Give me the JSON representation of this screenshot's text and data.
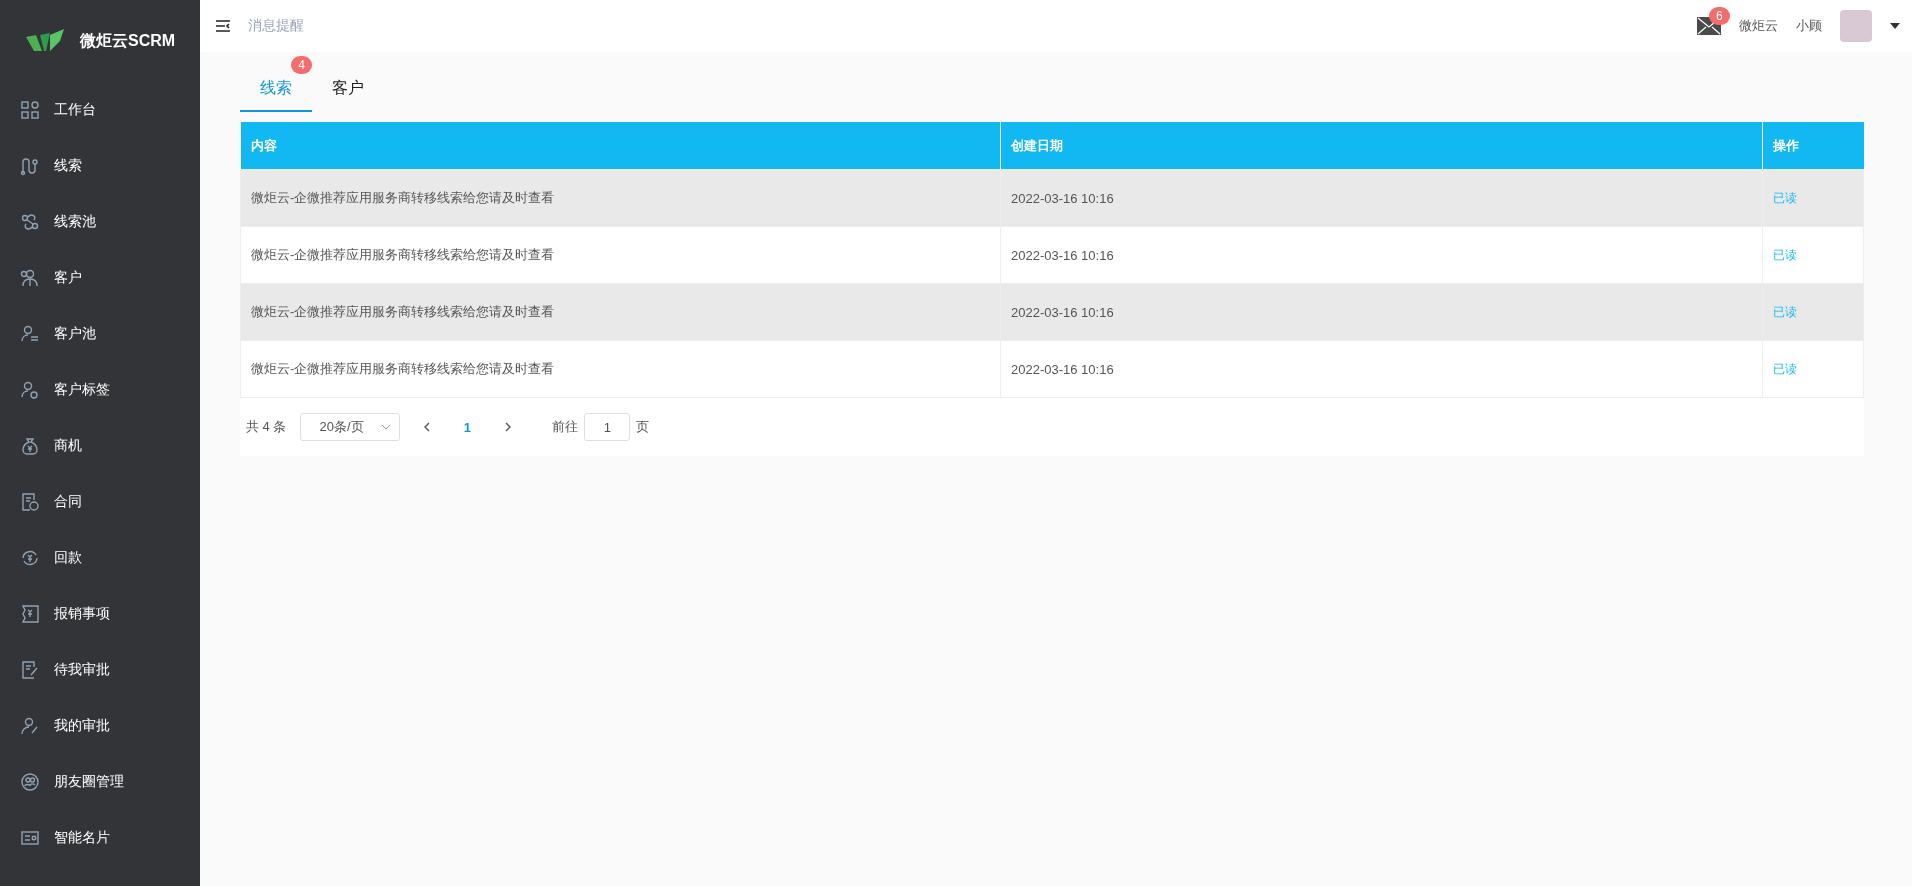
{
  "sidebar": {
    "logo_text": "微炬云SCRM",
    "items": [
      {
        "label": "工作台"
      },
      {
        "label": "线索"
      },
      {
        "label": "线索池"
      },
      {
        "label": "客户"
      },
      {
        "label": "客户池"
      },
      {
        "label": "客户标签"
      },
      {
        "label": "商机"
      },
      {
        "label": "合同"
      },
      {
        "label": "回款"
      },
      {
        "label": "报销事项"
      },
      {
        "label": "待我审批"
      },
      {
        "label": "我的审批"
      },
      {
        "label": "朋友圈管理"
      },
      {
        "label": "智能名片"
      }
    ]
  },
  "header": {
    "title": "消息提醒",
    "mail_badge": "6",
    "company": "微炬云",
    "user": "小顾"
  },
  "tabs": [
    {
      "label": "线索",
      "selected": true,
      "badge": "4"
    },
    {
      "label": "客户",
      "selected": false
    }
  ],
  "table": {
    "columns": [
      "内容",
      "创建日期",
      "操作"
    ],
    "rows": [
      {
        "content": "微炬云-企微推荐应用服务商转移线索给您请及时查看",
        "date": "2022-03-16 10:16",
        "action": "已读"
      },
      {
        "content": "微炬云-企微推荐应用服务商转移线索给您请及时查看",
        "date": "2022-03-16 10:16",
        "action": "已读"
      },
      {
        "content": "微炬云-企微推荐应用服务商转移线索给您请及时查看",
        "date": "2022-03-16 10:16",
        "action": "已读"
      },
      {
        "content": "微炬云-企微推荐应用服务商转移线索给您请及时查看",
        "date": "2022-03-16 10:16",
        "action": "已读"
      }
    ]
  },
  "pagination": {
    "total": "共 4 条",
    "page_size": "20条/页",
    "pages": [
      {
        "label": "1",
        "selected": true
      }
    ],
    "goto_label": "前往",
    "goto_value": "1",
    "goto_suffix": "页"
  }
}
